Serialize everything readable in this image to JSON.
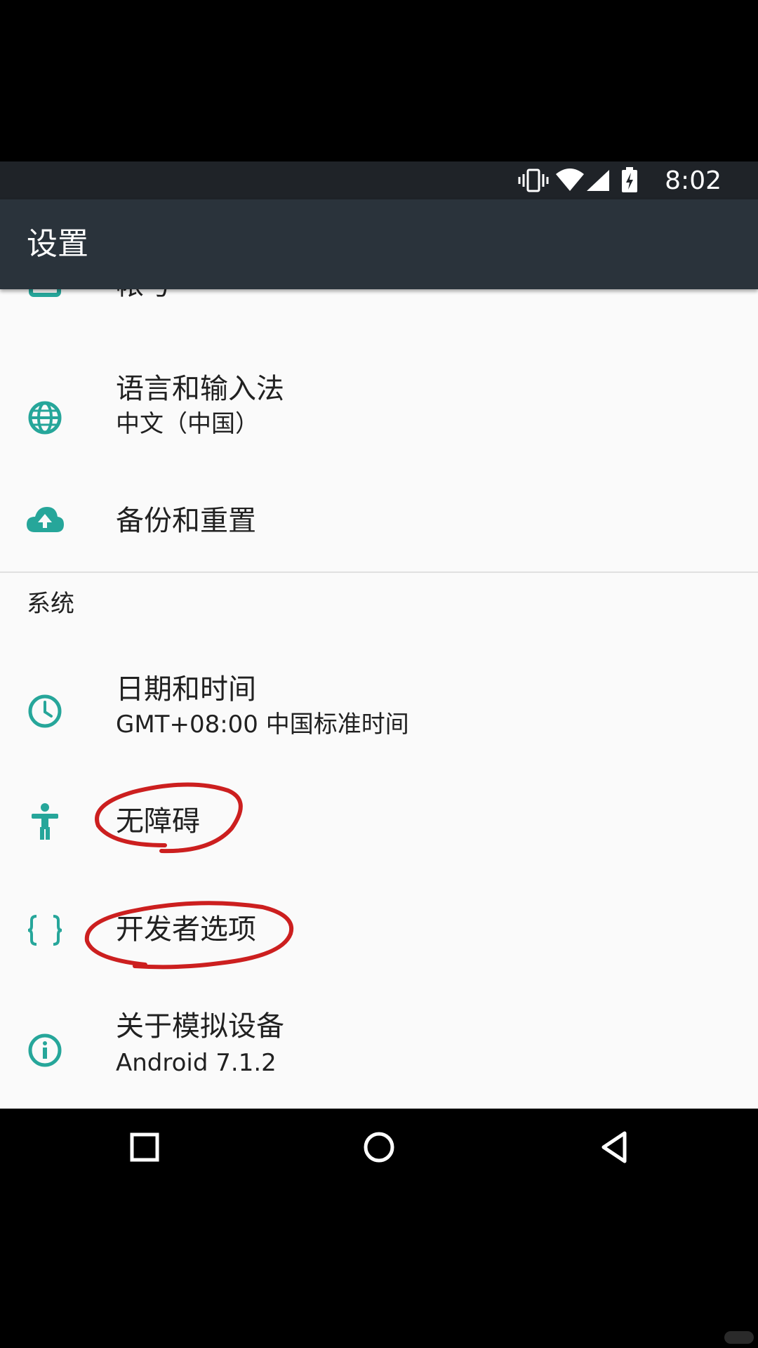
{
  "status_bar": {
    "time": "8:02",
    "icons": [
      "vibrate-icon",
      "wifi-icon",
      "cellular-signal-icon",
      "battery-charging-icon"
    ]
  },
  "app_bar": {
    "title": "设置"
  },
  "list": {
    "partial_item": {
      "label": "帐号",
      "icon": "account-icon"
    },
    "items_top": [
      {
        "label": "语言和输入法",
        "summary": "中文（中国）",
        "icon": "globe-icon"
      },
      {
        "label": "备份和重置",
        "icon": "cloud-upload-icon"
      }
    ],
    "system_section": {
      "header": "系统",
      "items": [
        {
          "label": "日期和时间",
          "summary": "GMT+08:00 中国标准时间",
          "icon": "clock-icon"
        },
        {
          "label": "无障碍",
          "icon": "accessibility-icon"
        },
        {
          "label": "开发者选项",
          "icon": "developer-braces-icon"
        },
        {
          "label": "关于模拟设备",
          "summary": "Android 7.1.2",
          "icon": "info-icon"
        }
      ]
    }
  },
  "annotations": [
    "red-circle-accessibility",
    "red-circle-developer-options"
  ],
  "nav_bar": {
    "buttons": [
      "recents-button",
      "home-button",
      "back-button"
    ]
  },
  "colors": {
    "accent": "#26a69a",
    "status_bar": "#1f2328",
    "app_bar": "#2a333b",
    "background": "#fafafa",
    "annotation": "#cc1f1f"
  }
}
